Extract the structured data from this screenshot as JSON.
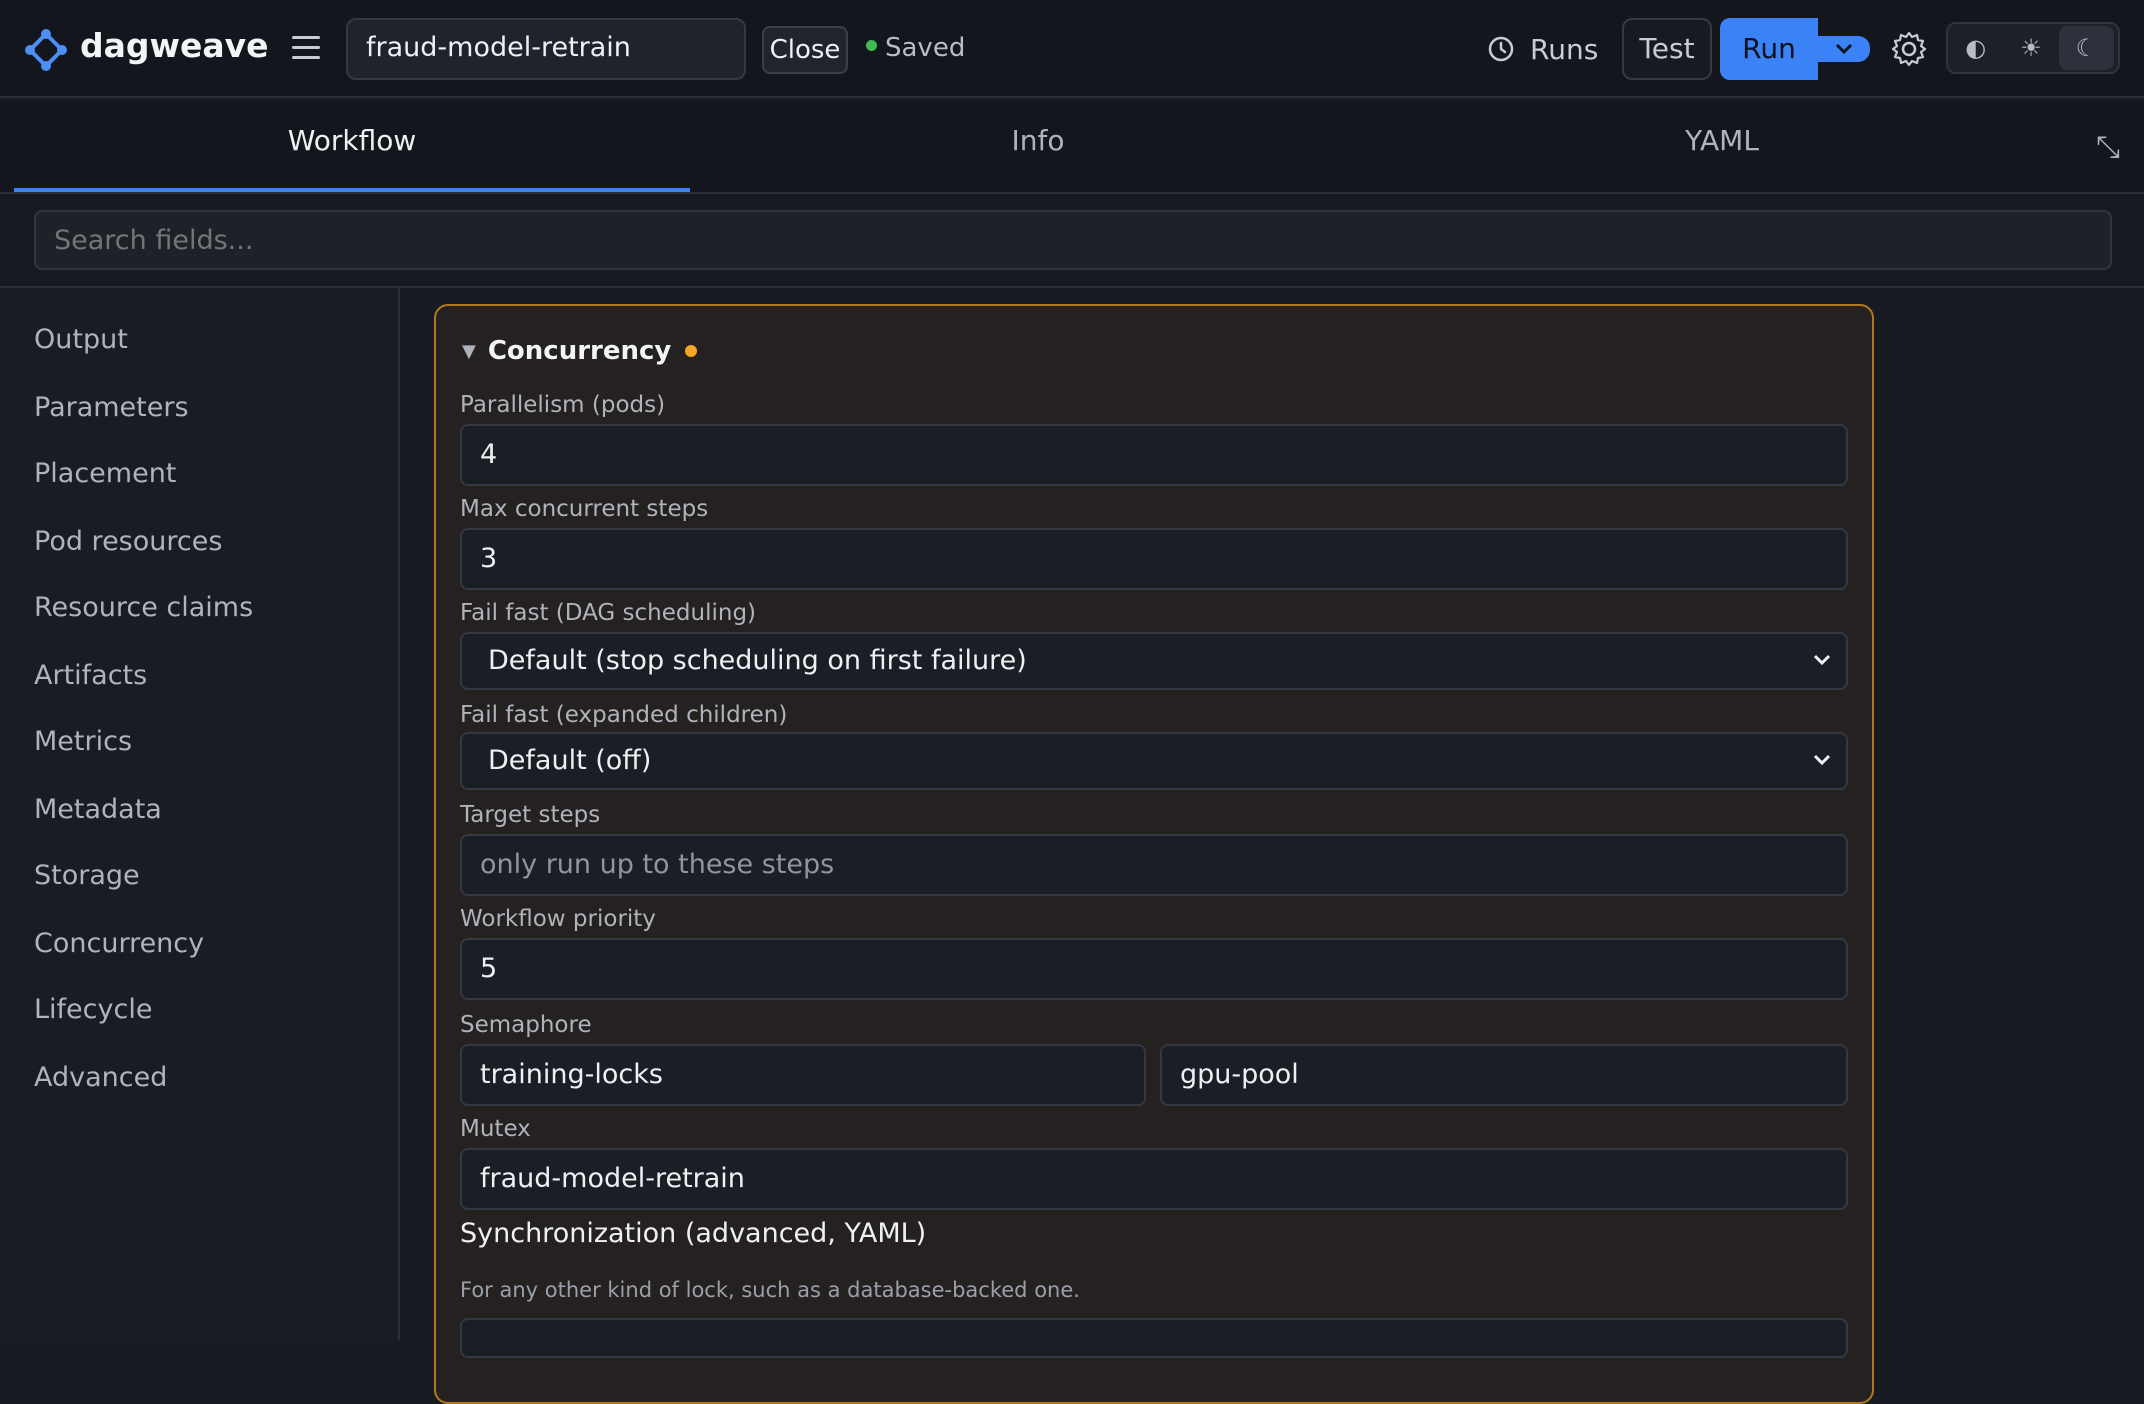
{
  "header": {
    "brand": "dagweave",
    "workflow_name": "fraud-model-retrain",
    "close_label": "Close",
    "saved_label": "Saved",
    "runs_label": "Runs",
    "test_label": "Test",
    "run_label": "Run",
    "theme_options": [
      "◐",
      "☀",
      "☾"
    ],
    "accent_color": "#3b82f6"
  },
  "tabs": [
    {
      "label": "Workflow",
      "active": true
    },
    {
      "label": "Info",
      "active": false
    },
    {
      "label": "YAML",
      "active": false
    }
  ],
  "search": {
    "placeholder": "Search fields..."
  },
  "sidebar": {
    "items": [
      {
        "label": "Output"
      },
      {
        "label": "Parameters"
      },
      {
        "label": "Placement"
      },
      {
        "label": "Pod resources"
      },
      {
        "label": "Resource claims"
      },
      {
        "label": "Artifacts"
      },
      {
        "label": "Metrics"
      },
      {
        "label": "Metadata"
      },
      {
        "label": "Storage"
      },
      {
        "label": "Concurrency"
      },
      {
        "label": "Lifecycle"
      },
      {
        "label": "Advanced"
      }
    ]
  },
  "panel": {
    "title": "Concurrency",
    "modified_color": "#f5a623",
    "parallelism": {
      "label": "Parallelism (pods)",
      "value": "4"
    },
    "max_steps": {
      "label": "Max concurrent steps",
      "value": "3"
    },
    "fail_fast_dag": {
      "label": "Fail fast (DAG scheduling)",
      "value": "Default (stop scheduling on first failure)"
    },
    "fail_fast_children": {
      "label": "Fail fast (expanded children)",
      "value": "Default (off)"
    },
    "target_steps": {
      "label": "Target steps",
      "placeholder": "only run up to these steps"
    },
    "priority": {
      "label": "Workflow priority",
      "value": "5"
    },
    "semaphore": {
      "label": "Semaphore",
      "name": "training-locks",
      "key": "gpu-pool"
    },
    "mutex": {
      "label": "Mutex",
      "value": "fraud-model-retrain"
    },
    "sync": {
      "title": "Synchronization (advanced, YAML)",
      "description": "For any other kind of lock, such as a database-backed one."
    }
  }
}
